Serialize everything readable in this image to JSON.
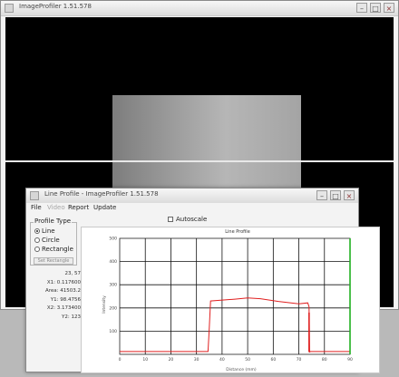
{
  "main_window": {
    "title": "ImageProfiler 1.51.578"
  },
  "controls": {
    "minimize": "–",
    "maximize": "□",
    "close": "×"
  },
  "line_profile_window": {
    "title": "Line Profile - ImageProfiler 1.51.578",
    "menu": [
      "File",
      "Video",
      "Report",
      "Update"
    ],
    "menu_disabled": [
      false,
      true,
      false,
      false
    ],
    "group_label": "Profile Type",
    "radios": [
      {
        "label": "Line",
        "selected": true
      },
      {
        "label": "Circle",
        "selected": false
      },
      {
        "label": "Rectangle",
        "selected": false
      }
    ],
    "group_button": "Set Rectangle",
    "stats": [
      "23, 57",
      "X1: 0.117600",
      "Area: 41503.2",
      "Y1: 98.4756",
      "X2: 3.173400",
      "Y2: 123"
    ],
    "checkbox": {
      "label": "Autoscale",
      "checked": false
    }
  },
  "chart_data": {
    "type": "line",
    "title": "Line Profile",
    "xlabel": "Distance (mm)",
    "ylabel": "Intensity",
    "xlim": [
      0,
      90
    ],
    "ylim": [
      0,
      500
    ],
    "xticks": [
      0,
      10,
      20,
      30,
      40,
      50,
      60,
      70,
      80,
      90
    ],
    "yticks": [
      100,
      200,
      300,
      400,
      500
    ],
    "ytick_labels": [
      "100",
      "200",
      "300",
      "400",
      "500"
    ],
    "grid": true,
    "series": [
      {
        "color": "#e02020",
        "x": [
          0,
          20,
          34.5,
          35,
          35.5,
          45,
          50,
          55,
          62,
          70,
          73.5,
          74,
          74.2,
          74.5,
          80,
          90
        ],
        "y": [
          12,
          12,
          12,
          115,
          230,
          238,
          243,
          240,
          228,
          218,
          222,
          205,
          10,
          12,
          12,
          12
        ]
      }
    ],
    "markers": [
      {
        "x": 74,
        "y0": 10,
        "y1": 180,
        "color": "#e02020"
      },
      {
        "x": 90,
        "y0": 0,
        "y1": 500,
        "color": "#20b020"
      }
    ]
  }
}
